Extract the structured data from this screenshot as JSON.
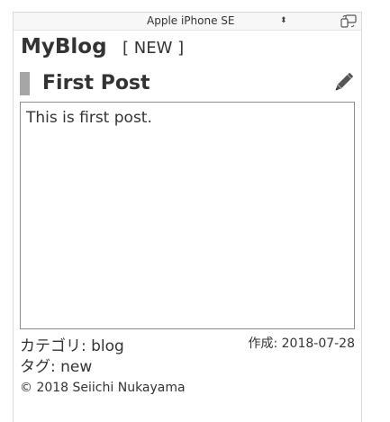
{
  "device_bar": {
    "selected_device": "Apple iPhone SE",
    "select_arrow": "⬍",
    "rotate_icon": "rotate-device-icon"
  },
  "header": {
    "site_title": "MyBlog",
    "new_link": "[ NEW ]"
  },
  "post": {
    "title": "First Post",
    "edit_icon": "pencil-icon",
    "body": "This is first post.",
    "category_label": "カテゴリ: ",
    "category_value": "blog",
    "tag_label": "タグ: ",
    "tag_value": "new",
    "created": "作成: 2018-07-28"
  },
  "footer": {
    "copyright": "© 2018 Seiichi Nukayama"
  },
  "colors": {
    "accent_bar": "#a6a6a6",
    "text": "#333333",
    "border": "#8c8c8c"
  }
}
